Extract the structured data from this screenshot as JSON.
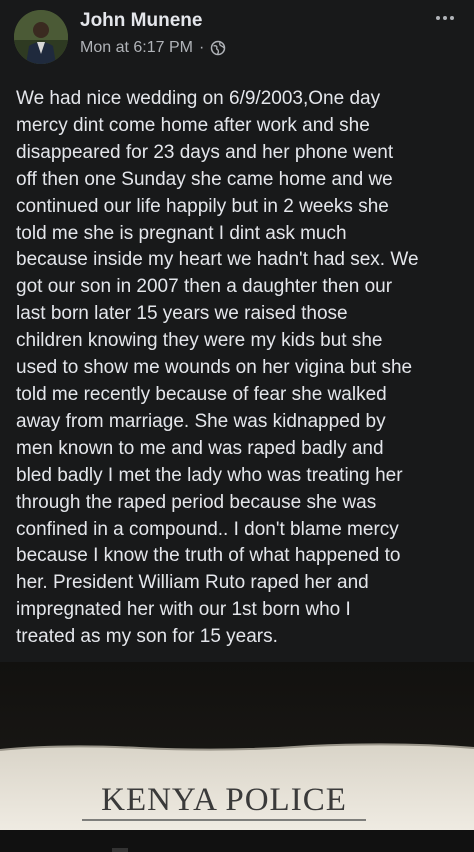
{
  "post": {
    "author": "John Munene",
    "timestamp": "Mon at 6:17 PM",
    "separator": "·",
    "audience_icon": "globe-icon",
    "more_icon": "more-dots-icon",
    "text_lines": [
      "We had nice wedding on 6/9/2003,One day",
      "mercy dint come home after work and she",
      "disappeared for 23 days and her phone went",
      "off then one Sunday she came home and we",
      "continued our life happily but in 2 weeks she",
      "told me she is pregnant I dint ask much",
      "because inside my heart we hadn't had sex. We",
      "got our son in 2007 then a daughter then our",
      "last born later 15 years we raised those",
      "children knowing they were my kids but she",
      "used to show me wounds on her vigina but she",
      "told me recently because of fear she walked",
      "away from marriage. She was kidnapped by",
      "men known to me and was raped badly and",
      "bled badly I met the lady who was treating her",
      "through the raped period because she was",
      "confined in a compound.. I don't blame mercy",
      "because I know the truth of what happened to",
      "her. President William Ruto raped her and",
      "impregnated her with our 1st born who I",
      "treated  as my son for 15 years."
    ]
  },
  "photo": {
    "document_text": "KENYA POLICE"
  },
  "colors": {
    "background": "#18191a",
    "text_primary": "#e4e6eb",
    "text_secondary": "#b0b3b8"
  }
}
